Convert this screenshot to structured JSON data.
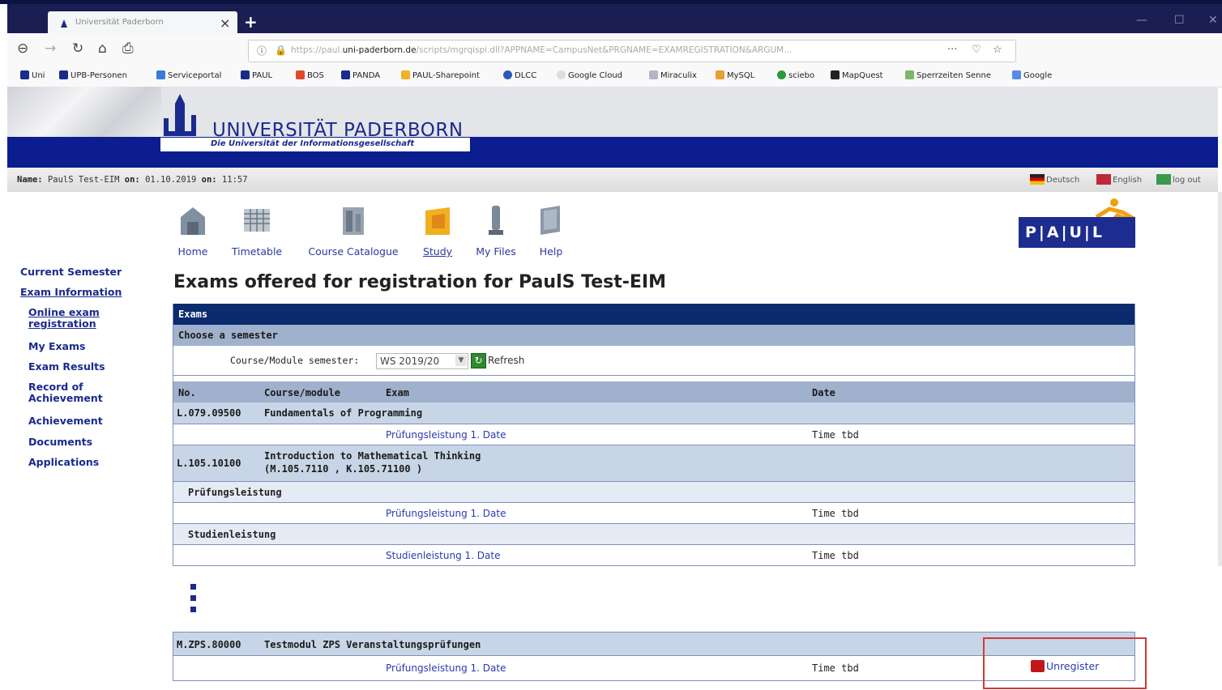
{
  "browser": {
    "tab_title": "Universität Paderborn",
    "url_prefix": "https://paul.",
    "url_domain": "uni-paderborn.de",
    "url_rest": "/scripts/mgrqispi.dll?APPNAME=CampusNet&PRGNAME=EXAMREGISTRATION&ARGUM...",
    "bookmarks": [
      "Uni",
      "UPB-Personen",
      "Serviceportal",
      "PAUL",
      "BOS",
      "PANDA",
      "PAUL-Sharepoint",
      "DLCC",
      "Google Cloud",
      "Miraculix",
      "MySQL",
      "sciebo",
      "MapQuest",
      "Sperrzeiten Senne",
      "Google"
    ]
  },
  "header": {
    "university": "UNIVERSITÄT PADERBORN",
    "tagline": "Die Universität der Informationsgesellschaft"
  },
  "userbar": {
    "name_label": "Name:",
    "name_value": "PaulS Test-EIM",
    "date_label": "on:",
    "date_value": "01.10.2019",
    "time_label": "on:",
    "time_value": "11:57",
    "lang_de": "Deutsch",
    "lang_en": "English",
    "logout": "log out"
  },
  "topnav": [
    "Home",
    "Timetable",
    "Course Catalogue",
    "Study",
    "My Files",
    "Help"
  ],
  "paul_logo": "P|A|U|L",
  "sidebar": {
    "current_semester": "Current Semester",
    "exam_information": "Exam Information",
    "online_exam_reg_1": "Online exam",
    "online_exam_reg_2": "registration",
    "my_exams": "My Exams",
    "exam_results": "Exam Results",
    "record_1": "Record of",
    "record_2": "Achievement",
    "achievement": "Achievement",
    "documents": "Documents",
    "applications": "Applications"
  },
  "main": {
    "title": "Exams offered for registration for PaulS Test-EIM",
    "section": "Exams",
    "choose_semester": "Choose a semester",
    "semester_label": "Course/Module semester:",
    "semester_value": "WS 2019/20",
    "refresh": "Refresh",
    "columns": {
      "no": "No.",
      "course": "Course/module",
      "exam": "Exam",
      "date": "Date"
    },
    "m1_no": "L.079.09500",
    "m1_name": "Fundamentals of Programming",
    "m1_exam": "Prüfungsleistung 1. Date",
    "m1_date": "Time tbd",
    "m2_no": "L.105.10100",
    "m2_name_1": "Introduction to Mathematical Thinking",
    "m2_name_2": "(M.105.7110 , K.105.71100 )",
    "m2_sub1": "Prüfungsleistung",
    "m2_sub1_exam": "Prüfungsleistung 1. Date",
    "m2_sub1_date": "Time tbd",
    "m2_sub2": "Studienleistung",
    "m2_sub2_exam": "Studienleistung 1. Date",
    "m2_sub2_date": "Time tbd",
    "m3_no": "M.ZPS.80000",
    "m3_name": "Testmodul ZPS Veranstaltungsprüfungen",
    "m3_exam": "Prüfungsleistung 1. Date",
    "m3_date": "Time tbd",
    "unregister": "Unregister"
  }
}
